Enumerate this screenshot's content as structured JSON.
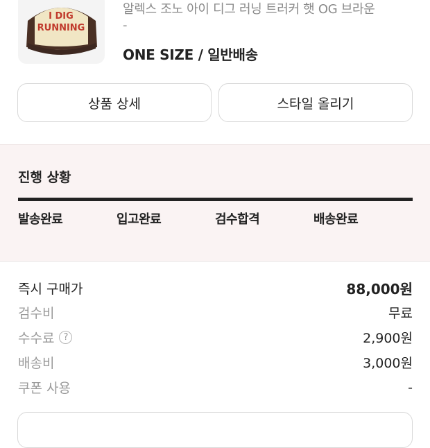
{
  "product": {
    "image_text_line1": "I DIG",
    "image_text_line2": "RUNNING",
    "name": "알렉스 조노 아이 디그 러닝 트러커 햇 OG 브라운",
    "name_suffix": "-",
    "size_option": "ONE SIZE / 일반배송"
  },
  "actions": {
    "detail_label": "상품 상세",
    "style_label": "스타일 올리기"
  },
  "progress": {
    "title": "진행 상황",
    "steps": [
      "발송완료",
      "입고완료",
      "검수합격",
      "배송완료"
    ],
    "completed_fraction": 1.0
  },
  "prices": {
    "instant_buy_label": "즉시 구매가",
    "instant_buy_value": "88,000원",
    "inspection_label": "검수비",
    "inspection_value": "무료",
    "fee_label": "수수료",
    "fee_value": "2,900원",
    "shipping_label": "배송비",
    "shipping_value": "3,000원",
    "coupon_label": "쿠폰 사용",
    "coupon_value": "-"
  },
  "icons": {
    "help": "question-circle-icon"
  },
  "colors": {
    "progress_bg": "#faf3f3",
    "progress_bar": "#222222",
    "hat_text": "#c0392b",
    "hat_brown": "#4a3024",
    "hat_cream": "#f1e6c4"
  }
}
